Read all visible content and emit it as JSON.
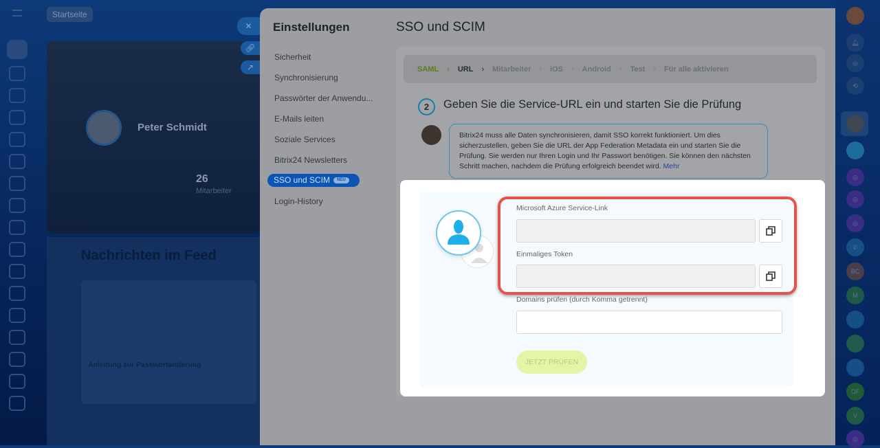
{
  "background": {
    "breadcrumb": "Startseite",
    "profile": {
      "name": "Peter Schmidt",
      "count": "26",
      "count_label": "Mitarbeiter"
    },
    "feed": {
      "title": "Nachrichten im Feed",
      "post_title": "Anleitung zur Passwortänderung"
    }
  },
  "settings": {
    "title": "Einstellungen",
    "menu": [
      {
        "label": "Sicherheit"
      },
      {
        "label": "Synchronisierung"
      },
      {
        "label": "Passwörter der Anwendu..."
      },
      {
        "label": "E-Mails leiten"
      },
      {
        "label": "Soziale Services"
      },
      {
        "label": "Bitrix24 Newsletters"
      },
      {
        "label": "SSO und SCIM",
        "badge": "NEU",
        "active": true
      },
      {
        "label": "Login-History"
      }
    ]
  },
  "page": {
    "title": "SSO und SCIM",
    "steps": [
      "SAML",
      "URL",
      "Mitarbeiter",
      "iOS",
      "Android",
      "Test",
      "Für alle aktivieren"
    ],
    "step_number": "2",
    "step_heading": "Geben Sie die Service-URL ein und starten Sie die Prüfung",
    "info_text": "Bitrix24 muss alle Daten synchronisieren, damit SSO korrekt funktioniert. Um dies sicherzustellen, geben Sie die URL der App Federation Metadata ein und starten Sie die Prüfung. Sie werden nur Ihren Login und Ihr Passwort benötigen. Sie können den nächsten Schritt machen, nachdem die Prüfung erfolgreich beendet wird.",
    "info_link": "Mehr",
    "form": {
      "service_link_label": "Microsoft Azure Service-Link",
      "token_label": "Einmaliges Token",
      "domains_label": "Domains prüfen (durch Komma getrennt)",
      "check_button": "JETZT PRÜFEN"
    }
  },
  "right_bar": {
    "initials": [
      "BC",
      "M",
      "OF",
      "V"
    ]
  },
  "colors": {
    "accent": "#0a55b5",
    "highlight": "#e5534b",
    "success": "#bbed21"
  }
}
